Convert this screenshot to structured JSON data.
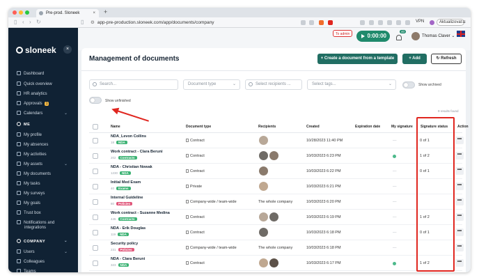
{
  "browser": {
    "tab_title": "Pre-prod. Sloneek",
    "new_tab_label": "+",
    "url": "app-pre-production.sloneek.com/app/documents/company",
    "vpn_label": "VPN",
    "update_label": "Aktualizovat"
  },
  "sidebar": {
    "logo_text": "sloneek",
    "collapse_glyph": "×",
    "top_items": [
      {
        "label": "Dashboard",
        "icon": "dashboard-icon"
      },
      {
        "label": "Quick overview",
        "icon": "overview-icon"
      },
      {
        "label": "HR analytics",
        "icon": "analytics-icon"
      },
      {
        "label": "Approvals",
        "icon": "approvals-icon",
        "badge": "1"
      },
      {
        "label": "Calendars",
        "icon": "calendar-icon",
        "chevron": "⌄"
      }
    ],
    "me_section": "ME",
    "me_items": [
      {
        "label": "My profile"
      },
      {
        "label": "My absences"
      },
      {
        "label": "My activities"
      },
      {
        "label": "My assets",
        "chevron": "⌄"
      },
      {
        "label": "My documents"
      },
      {
        "label": "My tasks"
      },
      {
        "label": "My surveys"
      },
      {
        "label": "My goals"
      },
      {
        "label": "Trust box"
      },
      {
        "label": "Notifications and"
      },
      {
        "label": "integrations"
      }
    ],
    "company_section": "COMPANY",
    "company_items": [
      {
        "label": "Users",
        "chevron": "⌄"
      },
      {
        "label": "Colleagues"
      },
      {
        "label": "Teams"
      }
    ]
  },
  "topbar": {
    "to_admin": "To admin",
    "timer": "00:00:00",
    "notification_count": "40",
    "user_name": "Thomas Claver",
    "user_chevron": "⌄"
  },
  "page": {
    "title": "Management of documents",
    "create_template_button": "+ Create a document from a template",
    "add_button": "+ Add",
    "refresh_button": "↻ Refresh"
  },
  "filters": {
    "search_placeholder": "Search...",
    "doc_type_placeholder": "Document type",
    "recipients_placeholder": "Select recipients ...",
    "tags_placeholder": "Select tags...",
    "show_archived": "Show archived",
    "show_unfinished": "Show unfinished",
    "results_text": "9 results found"
  },
  "table": {
    "columns": [
      "Name",
      "Document type",
      "Recipients",
      "Created",
      "Expiration date",
      "My signature",
      "Signature status",
      "Action"
    ],
    "rows": [
      {
        "name": "NDA_Levon Collins",
        "id": "18",
        "tag": "NDA",
        "tag_color": "#3bb273",
        "type": "Contract",
        "recipients_text": "",
        "avatars": 1,
        "created": "10/28/2023 11:40 PM",
        "my_sig": "—",
        "status": "0 of 1",
        "action": "•••"
      },
      {
        "name": "Work contract - Clara Beruni",
        "id": "202",
        "tag": "Contracts",
        "tag_color": "#3bb273",
        "type": "Contract",
        "recipients_text": "",
        "avatars": 2,
        "created": "10/03/2023 6:23 PM",
        "my_sig": "dot",
        "status": "1 of 2",
        "action": "•••"
      },
      {
        "name": "NDA - Christian Nowak",
        "id": "1230",
        "tag": "NDA",
        "tag_color": "#3bb273",
        "type": "Contract",
        "recipients_text": "",
        "avatars": 1,
        "created": "10/03/2023 6:22 PM",
        "my_sig": "—",
        "status": "0 of 1",
        "action": "•••"
      },
      {
        "name": "Initial Med Exam",
        "id": "40",
        "tag": "Exams",
        "tag_color": "#3bb273",
        "type": "Private",
        "recipients_text": "",
        "avatars": 1,
        "created": "10/03/2023 6:21 PM",
        "my_sig": "—",
        "status": "",
        "action": "•••"
      },
      {
        "name": "Internal Guideline",
        "id": "80",
        "tag": "Policies",
        "tag_color": "#e0567a",
        "type": "Company-wide / team-wide",
        "recipients_text": "The whole company",
        "avatars": 0,
        "created": "10/03/2023 6:20 PM",
        "my_sig": "—",
        "status": "",
        "action": "•••"
      },
      {
        "name": "Work contract - Suzanne Medina",
        "id": "445",
        "tag": "Contracts",
        "tag_color": "#3bb273",
        "type": "Contract",
        "recipients_text": "",
        "avatars": 2,
        "created": "10/03/2023 6:19 PM",
        "my_sig": "—",
        "status": "1 of 2",
        "action": "•••"
      },
      {
        "name": "NDA - Erik Douglas",
        "id": "119",
        "tag": "NDA",
        "tag_color": "#3bb273",
        "type": "Contract",
        "recipients_text": "",
        "avatars": 1,
        "created": "10/03/2023 6:18 PM",
        "my_sig": "—",
        "status": "0 of 1",
        "action": "•••"
      },
      {
        "name": "Security policy",
        "id": "231",
        "tag": "Policies",
        "tag_color": "#e0567a",
        "type": "Company-wide / team-wide",
        "recipients_text": "The whole company",
        "avatars": 0,
        "created": "10/03/2023 6:18 PM",
        "my_sig": "—",
        "status": "",
        "action": "•••"
      },
      {
        "name": "NDA - Clara Beruni",
        "id": "323",
        "tag": "NDA",
        "tag_color": "#3bb273",
        "type": "Contract",
        "recipients_text": "",
        "avatars": 2,
        "created": "10/03/2023 6:17 PM",
        "my_sig": "dot",
        "status": "1 of 2",
        "action": "•••"
      }
    ]
  },
  "colors": {
    "sidebar_bg": "#102234",
    "accent": "#216e63",
    "annotation_red": "#e0261f",
    "signed_dot": "#4cb98b"
  }
}
